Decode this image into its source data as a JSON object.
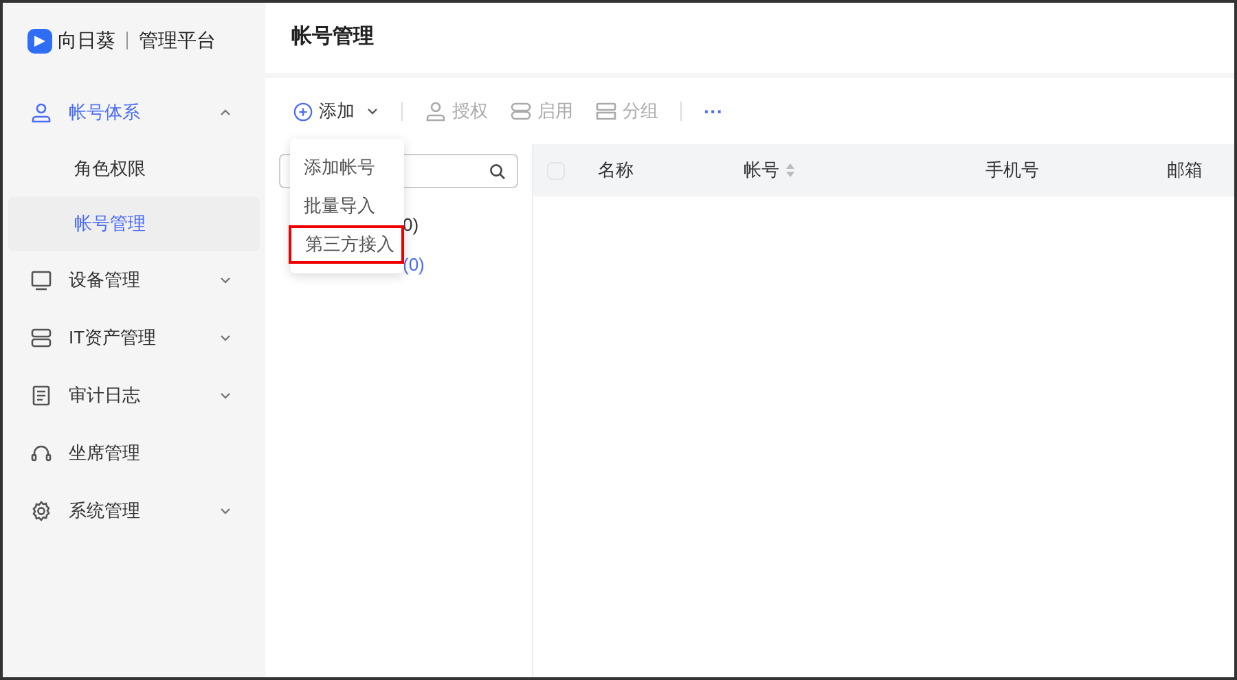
{
  "brand": {
    "name": "向日葵",
    "subtitle": "管理平台"
  },
  "sidebar": {
    "items": [
      {
        "label": "帐号体系",
        "expanded": true,
        "selected": true,
        "children": [
          {
            "label": "角色权限",
            "selected": false
          },
          {
            "label": "帐号管理",
            "selected": true
          }
        ]
      },
      {
        "label": "设备管理",
        "expanded": false,
        "selected": false
      },
      {
        "label": "IT资产管理",
        "expanded": false,
        "selected": false
      },
      {
        "label": "审计日志",
        "expanded": false,
        "selected": false
      },
      {
        "label": "坐席管理",
        "selected": false
      },
      {
        "label": "系统管理",
        "expanded": false,
        "selected": false
      }
    ]
  },
  "page_title": "帐号管理",
  "toolbar": {
    "add": "添加",
    "actions": [
      {
        "label": "授权",
        "disabled": true
      },
      {
        "label": "启用",
        "disabled": true
      },
      {
        "label": "分组",
        "disabled": true
      }
    ],
    "more": "···"
  },
  "dropdown": {
    "items": [
      {
        "label": "添加帐号",
        "highlighted": false
      },
      {
        "label": "批量导入",
        "highlighted": false
      },
      {
        "label": "第三方接入",
        "highlighted": true
      }
    ]
  },
  "tree": {
    "items": [
      {
        "label": "0)",
        "selected": false
      },
      {
        "label": "(0)",
        "selected": true
      }
    ]
  },
  "table": {
    "select_all_checked": false,
    "columns": [
      {
        "label": "名称",
        "sortable": false
      },
      {
        "label": "帐号",
        "sortable": true
      },
      {
        "label": "手机号",
        "sortable": false
      },
      {
        "label": "邮箱",
        "sortable": false
      }
    ]
  }
}
